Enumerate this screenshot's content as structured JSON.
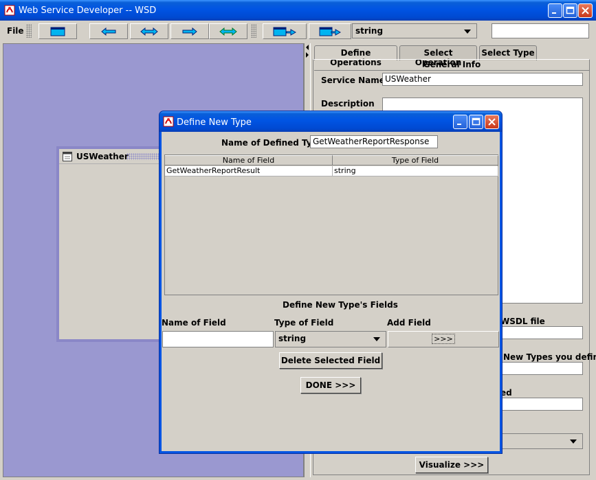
{
  "window": {
    "title": "Web Service Developer -- WSD"
  },
  "menubar": {
    "file": "File"
  },
  "toolbar": {
    "type_combo_value": "string",
    "search_value": ""
  },
  "desktop": {
    "internal_frame_title": "USWeather"
  },
  "tabs": [
    {
      "label": "Define Operations"
    },
    {
      "label": "Select Operation"
    },
    {
      "label": "Select Type"
    }
  ],
  "general_info": {
    "header": "General Info",
    "service_name_label": "Service Name",
    "service_name_value": "USWeather",
    "description_label": "Description",
    "wsdl_label_fragment": "WSDL file",
    "new_types_label_fragment": "New Types you define",
    "label_fragment_ed": "ed",
    "visualize_button": "Visualize >>>"
  },
  "dialog": {
    "title": "Define New Type",
    "name_of_defined_type_label": "Name of Defined Type",
    "name_of_defined_type_value": "GetWeatherReportResponse",
    "table": {
      "columns": [
        "Name of Field",
        "Type of Field"
      ],
      "rows": [
        [
          "GetWeatherReportResult",
          "string"
        ]
      ]
    },
    "define_fields_header": "Define New Type's Fields",
    "name_of_field_label": "Name of Field",
    "type_of_field_label": "Type of Field",
    "add_field_label": "Add Field",
    "name_of_field_value": "",
    "type_of_field_value": "string",
    "add_field_button": ">>>",
    "delete_button": "Delete Selected Field",
    "done_button": "DONE >>>"
  },
  "colors": {
    "title_bar": "#0054e3",
    "desktop": "#9a98d0",
    "panel": "#d4d0c8"
  }
}
